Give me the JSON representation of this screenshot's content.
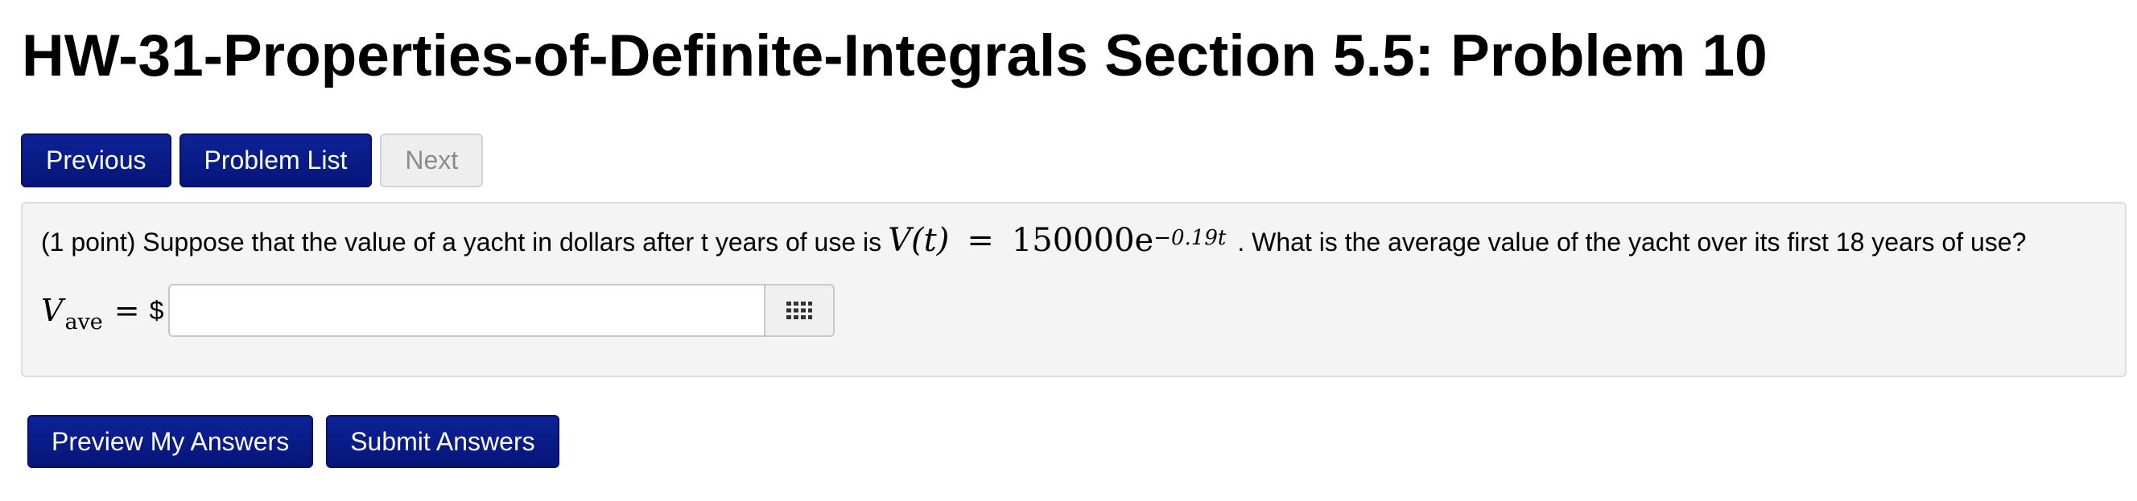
{
  "page": {
    "title": "HW-31-Properties-of-Definite-Integrals Section 5.5: Problem 10"
  },
  "nav": {
    "previous_label": "Previous",
    "problem_list_label": "Problem List",
    "next_label": "Next"
  },
  "problem": {
    "points_text": "(1 point) Suppose that the value of a yacht in dollars after t years of use is",
    "formula": {
      "lhs": "V(t)",
      "equals": "=",
      "base": "150000e",
      "exponent": "−0.19t"
    },
    "question_text": ". What is the average value of the yacht over its first 18 years of use?",
    "answer": {
      "label_var": "V",
      "label_sub": "ave",
      "equals": "=",
      "unit": "$",
      "value": "",
      "placeholder": ""
    },
    "keypad_icon": "grid-keypad-icon"
  },
  "actions": {
    "preview_label": "Preview My Answers",
    "submit_label": "Submit Answers"
  },
  "colors": {
    "primary_button": "#0b1f8a",
    "disabled_button": "#eeeeee",
    "problem_background": "#f4f4f4"
  }
}
